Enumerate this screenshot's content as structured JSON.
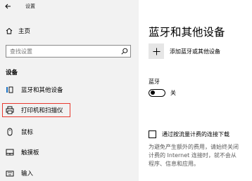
{
  "window": {
    "title": "设置"
  },
  "sidebar": {
    "home_label": "主页",
    "search_placeholder": "查找设置",
    "section_heading": "设备",
    "items": [
      {
        "label": "蓝牙和其他设备",
        "icon": "bluetooth-device-icon"
      },
      {
        "label": "打印机和扫描仪",
        "icon": "printer-icon",
        "highlighted": true
      },
      {
        "label": "鼠标",
        "icon": "mouse-icon"
      },
      {
        "label": "触摸板",
        "icon": "touchpad-icon"
      },
      {
        "label": "输入",
        "icon": "keyboard-icon"
      }
    ]
  },
  "main": {
    "title": "蓝牙和其他设备",
    "add_device_label": "添加蓝牙或其他设备",
    "bluetooth_label": "蓝牙",
    "bluetooth_state": "关",
    "metered_label": "通过按流量计费的连接下载",
    "metered_desc_lines": [
      "为避免产生额外的费用，请始终关闭",
      "计费的 Internet 连接时，就不会从",
      "程序、信息和应用。"
    ]
  },
  "colors": {
    "highlight": "#e8392f",
    "sidebar_bg": "#f2f2f2"
  }
}
